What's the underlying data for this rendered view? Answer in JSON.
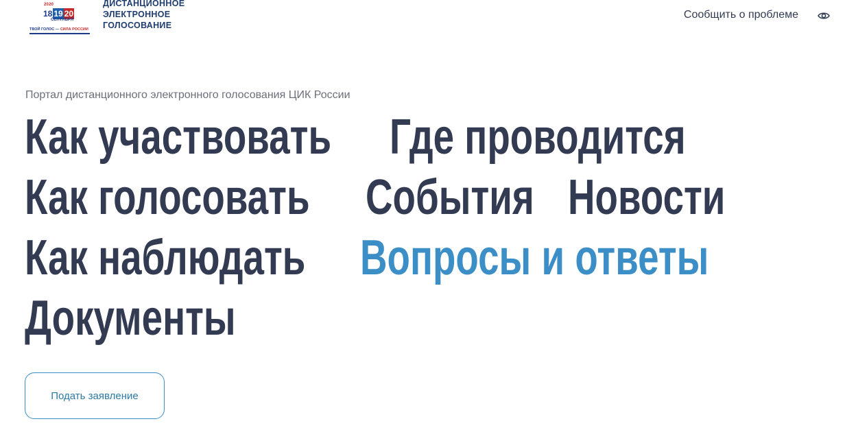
{
  "header": {
    "logo": {
      "year": "2020",
      "day1": "18",
      "day2": "19",
      "day3": "20",
      "month": "СЕНТЯБРЯ",
      "slogan_part1": "ТВОЙ ГОЛОС — ",
      "slogan_part2": "СИЛА РОССИИ"
    },
    "title_lines": [
      "ДИСТАНЦИОННОЕ",
      "ЭЛЕКТРОННОЕ",
      "ГОЛОСОВАНИЕ"
    ],
    "report_link": "Сообщить о проблеме",
    "accessibility_icon": "eye-icon"
  },
  "main": {
    "subtitle": "Портал дистанционного электронного голосования ЦИК России",
    "nav": [
      [
        "Как участвовать",
        "Где проводится"
      ],
      [
        "Как голосовать",
        "События",
        "Новости"
      ],
      [
        "Как наблюдать",
        "Вопросы и ответы"
      ],
      [
        "Документы"
      ]
    ],
    "apply_button": "Подать заявление"
  },
  "colors": {
    "text": "#333b52",
    "accent": "#3b8ec6",
    "brand_blue": "#1f3c88",
    "brand_red": "#c62828"
  }
}
